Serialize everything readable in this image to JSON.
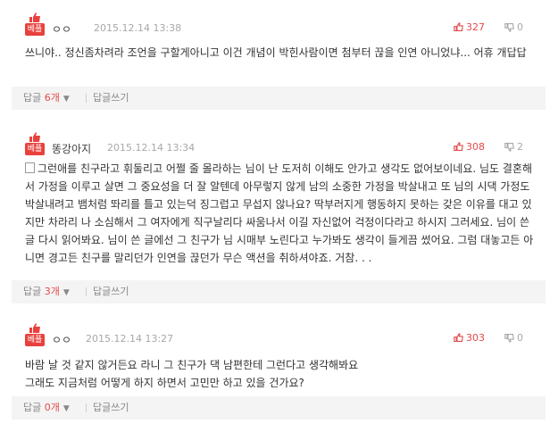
{
  "comments": [
    {
      "badge": "베플",
      "author": "ㅇㅇ",
      "date": "2015.12.14 13:38",
      "likes": "327",
      "dislikes": "0",
      "text": "쓰니야.. 정신좀차려라 조언을 구할게아니고 이건 개념이 박힌사람이면 첨부터 끊을 인연 아니었냐... 어휴 개답답",
      "reply_label": "답글",
      "reply_count": "6개",
      "write_label": "답글쓰기"
    },
    {
      "badge": "베플",
      "author": "똥강아지",
      "date": "2015.12.14 13:34",
      "likes": "308",
      "dislikes": "2",
      "text": "그런애를 친구라고 휘둘리고 어쩔 줄 몰라하는 님이 난 도저히 이해도 안가고 생각도 없어보이네요. 님도 결혼해서 가정을 이루고 살면 그 중요성을 더 잘 알텐데 아무렇지 않게 남의 소중한 가정을 박살내고 또 님의 시댁 가정도 박살내려고 뱀처럼 똬리를 틀고 있는덕 징그럽고 무섭지 않나요? 딱부러지게 행동하지 못하는 갖은 이유를 대고 있지만 차라리 나 소심해서 그 여자에게 직구날리다 싸움나서 이길 자신없어 걱정이다라고 하시지 그러세요. 님이 쓴 글 다시 읽어봐요. 님이 쓴 글에선 그 친구가 님 시매부 노린다고 누가봐도 생각이 들게끔 썼어요. 그럼 대놓고든 아니면 경고든 친구를 말리던가 인연을 끊던가 무슨 액션을 취하셔야죠. 거참. . .",
      "reply_label": "답글",
      "reply_count": "3개",
      "write_label": "답글쓰기"
    },
    {
      "badge": "베플",
      "author": "ㅇㅇ",
      "date": "2015.12.14 13:27",
      "likes": "303",
      "dislikes": "0",
      "text_lines": [
        "바람 날 것 같지 않거든요 라니 그 친구가 댁 남편한테 그런다고 생각해봐요",
        "그래도 지금처럼 어떻게 하지 하면서 고민만 하고 있을 건가요?"
      ],
      "reply_label": "답글",
      "reply_count": "0개",
      "write_label": "답글쓰기"
    }
  ],
  "icons": {
    "best": "thumbs-up-icon",
    "like": "thumbs-up-icon",
    "dislike": "thumbs-down-icon",
    "memo": "memo-icon",
    "expand": "caret-down-icon"
  },
  "colors": {
    "accent": "#e8413d",
    "count_red": "#e34a4a",
    "muted": "#a8a8a8",
    "bar_bg": "#f4f4f4"
  }
}
